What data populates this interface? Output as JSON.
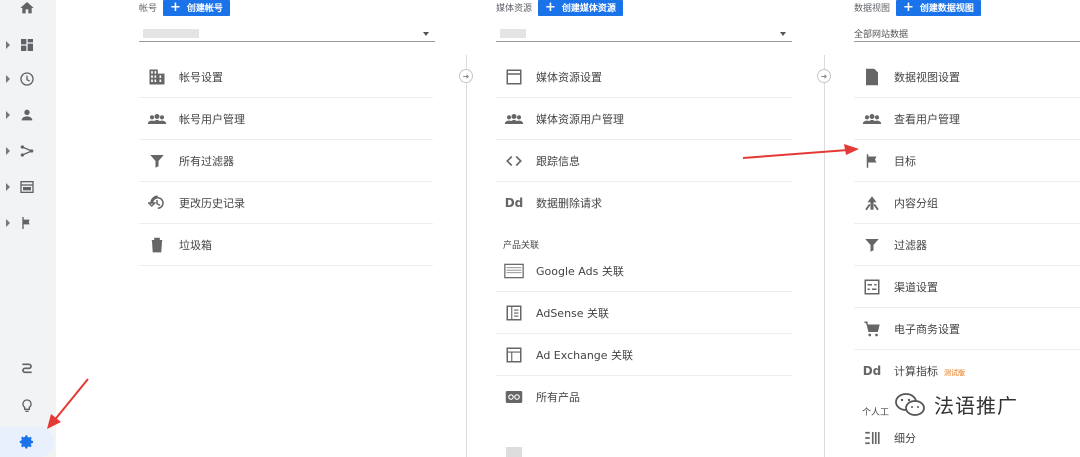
{
  "rail": {
    "items": [
      {
        "name": "home-icon"
      },
      {
        "name": "dashboard-icon"
      },
      {
        "name": "clock-icon"
      },
      {
        "name": "person-icon"
      },
      {
        "name": "acquisition-icon"
      },
      {
        "name": "behavior-icon"
      },
      {
        "name": "flag-icon"
      }
    ],
    "bottom": [
      {
        "name": "route-icon"
      },
      {
        "name": "lightbulb-icon"
      },
      {
        "name": "gear-icon"
      }
    ]
  },
  "account": {
    "label": "帐号",
    "create_label": "创建帐号",
    "items": [
      {
        "icon": "building-icon",
        "label": "帐号设置"
      },
      {
        "icon": "people-icon",
        "label": "帐号用户管理"
      },
      {
        "icon": "filter-icon",
        "label": "所有过滤器"
      },
      {
        "icon": "history-icon",
        "label": "更改历史记录"
      },
      {
        "icon": "trash-icon",
        "label": "垃圾箱"
      }
    ]
  },
  "property": {
    "label": "媒体资源",
    "create_label": "创建媒体资源",
    "items": [
      {
        "icon": "window-icon",
        "label": "媒体资源设置"
      },
      {
        "icon": "people-icon",
        "label": "媒体资源用户管理"
      },
      {
        "icon": "code-icon",
        "label": "跟踪信息"
      },
      {
        "icon": "dd-icon",
        "label": "数据删除请求"
      }
    ],
    "product_linking_title": "产品关联",
    "links": [
      {
        "icon": "google-ads-icon",
        "label": "Google Ads 关联"
      },
      {
        "icon": "adsense-icon",
        "label": "AdSense 关联"
      },
      {
        "icon": "ad-exchange-icon",
        "label": "Ad Exchange 关联"
      },
      {
        "icon": "all-products-icon",
        "label": "所有产品"
      }
    ]
  },
  "view": {
    "label": "数据视图",
    "create_label": "创建数据视图",
    "selected": "全部网站数据",
    "items": [
      {
        "icon": "document-icon",
        "label": "数据视图设置",
        "badge": ""
      },
      {
        "icon": "people-icon",
        "label": "查看用户管理",
        "badge": ""
      },
      {
        "icon": "flag-icon",
        "label": "目标",
        "badge": ""
      },
      {
        "icon": "content-grouping-icon",
        "label": "内容分组",
        "badge": ""
      },
      {
        "icon": "filter-icon",
        "label": "过滤器",
        "badge": ""
      },
      {
        "icon": "channel-settings-icon",
        "label": "渠道设置",
        "badge": ""
      },
      {
        "icon": "cart-icon",
        "label": "电子商务设置",
        "badge": ""
      },
      {
        "icon": "dd-icon",
        "label": "计算指标",
        "badge": "测试版"
      }
    ],
    "personal_title": "个人工",
    "segments_label": "细分"
  },
  "watermark": "法语推广",
  "colors": {
    "accent": "#1a73e8",
    "arrow": "#e53935",
    "rail": "#f1f3f4"
  }
}
